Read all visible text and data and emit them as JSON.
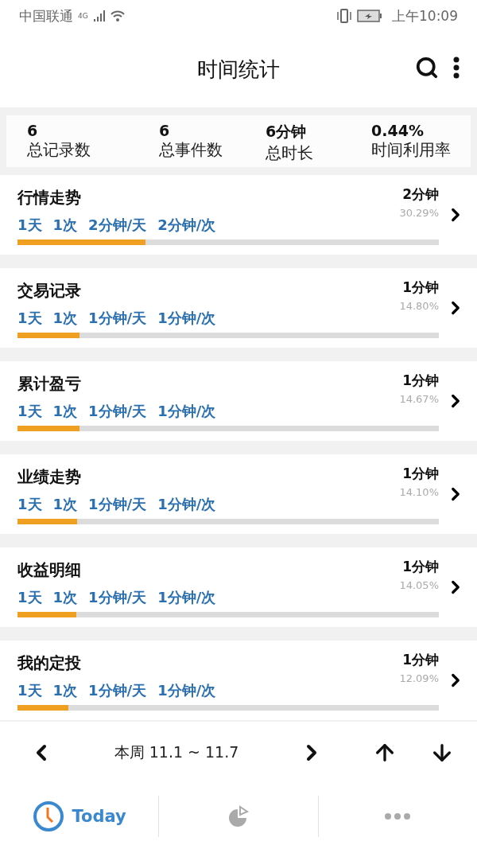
{
  "status_bar": {
    "carrier": "中国联通",
    "network": "4G",
    "time": "上午10:09"
  },
  "app_bar": {
    "title": "时间统计"
  },
  "summary": [
    {
      "value": "6",
      "label": "总记录数"
    },
    {
      "value": "6",
      "label": "总事件数"
    },
    {
      "value": "6分钟",
      "label": "总时长"
    },
    {
      "value": "0.44%",
      "label": "时间利用率"
    }
  ],
  "events": [
    {
      "name": "行情走势",
      "days": "1天",
      "count": "1次",
      "per_day": "2分钟/天",
      "per_time": "2分钟/次",
      "duration": "2分钟",
      "share": "30.29%",
      "level": 0.3029
    },
    {
      "name": "交易记录",
      "days": "1天",
      "count": "1次",
      "per_day": "1分钟/天",
      "per_time": "1分钟/次",
      "duration": "1分钟",
      "share": "14.80%",
      "level": 0.148
    },
    {
      "name": "累计盈亏",
      "days": "1天",
      "count": "1次",
      "per_day": "1分钟/天",
      "per_time": "1分钟/次",
      "duration": "1分钟",
      "share": "14.67%",
      "level": 0.1467
    },
    {
      "name": "业绩走势",
      "days": "1天",
      "count": "1次",
      "per_day": "1分钟/天",
      "per_time": "1分钟/次",
      "duration": "1分钟",
      "share": "14.10%",
      "level": 0.141
    },
    {
      "name": "收益明细",
      "days": "1天",
      "count": "1次",
      "per_day": "1分钟/天",
      "per_time": "1分钟/次",
      "duration": "1分钟",
      "share": "14.05%",
      "level": 0.1405
    },
    {
      "name": "我的定投",
      "days": "1天",
      "count": "1次",
      "per_day": "1分钟/天",
      "per_time": "1分钟/次",
      "duration": "1分钟",
      "share": "12.09%",
      "level": 0.1209
    }
  ],
  "period_nav": {
    "label": "本周 11.1 ~ 11.7"
  },
  "tabs": [
    {
      "kind": "clock",
      "label": "Today",
      "selected": true
    },
    {
      "kind": "chart",
      "selected": false
    },
    {
      "kind": "more",
      "selected": false
    }
  ]
}
